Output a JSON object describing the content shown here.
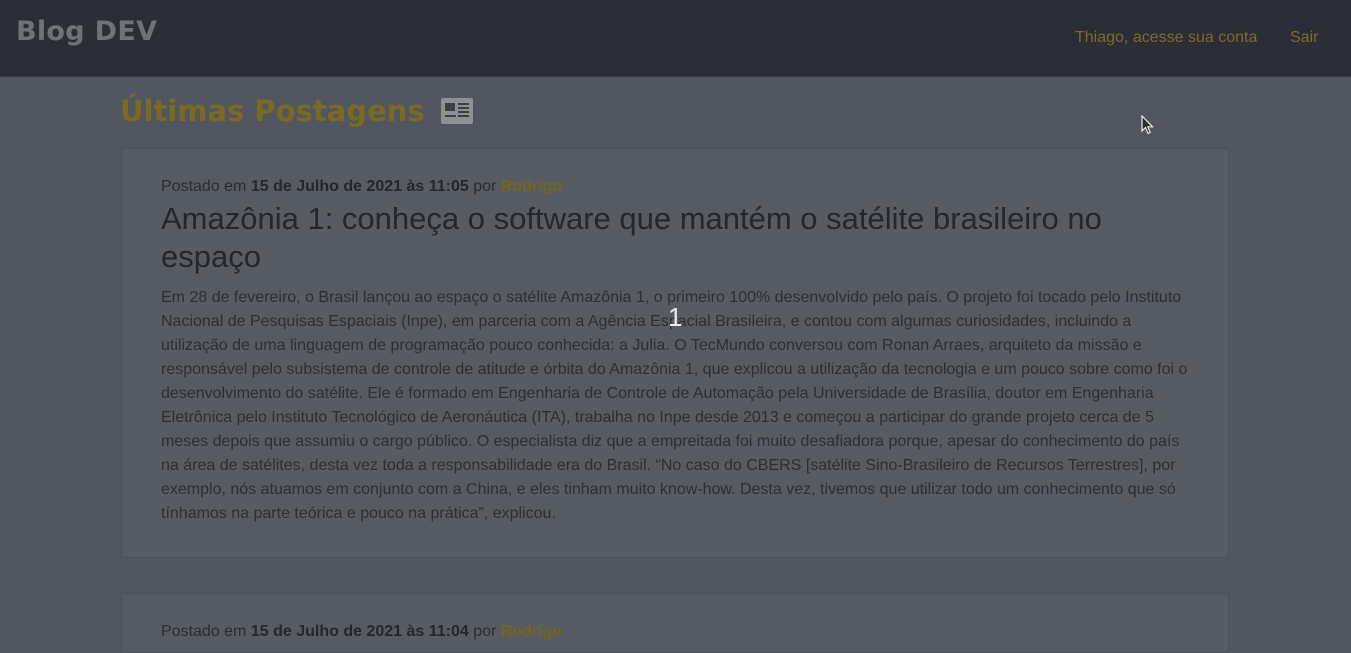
{
  "navbar": {
    "brand": "Blog DEV",
    "account_link": "Thiago, acesse sua conta",
    "logout_link": "Sair"
  },
  "page": {
    "title": "Últimas Postagens",
    "title_icon": "newspaper-icon"
  },
  "posts": [
    {
      "prefix": "Postado em",
      "date": "15 de Julho de 2021 às 11:05",
      "by": "por",
      "author": "Rodrigo",
      "title": "Amazônia 1: conheça o software que mantém o satélite brasileiro no espaço",
      "body": "Em 28 de fevereiro, o Brasil lançou ao espaço o satélite Amazônia 1, o primeiro 100% desenvolvido pelo país. O projeto foi tocado pelo Instituto Nacional de Pesquisas Espaciais (Inpe), em parceria com a Agência Espacial Brasileira, e contou com algumas curiosidades, incluindo a utilização de uma linguagem de programação pouco conhecida: a Julia. O TecMundo conversou com Ronan Arraes, arquiteto da missão e responsável pelo subsistema de controle de atitude e órbita do Amazônia 1, que explicou a utilização da tecnologia e um pouco sobre como foi o desenvolvimento do satélite. Ele é formado em Engenharia de Controle de Automação pela Universidade de Brasília, doutor em Engenharia Eletrônica pelo Instituto Tecnológico de Aeronáutica (ITA), trabalha no Inpe desde 2013 e começou a participar do grande projeto cerca de 5 meses depois que assumiu o cargo público. O especialista diz que a empreitada foi muito desafiadora porque, apesar do conhecimento do país na área de satélites, desta vez toda a responsabilidade era do Brasil. “No caso do CBERS [satélite Sino-Brasileiro de Recursos Terrestres], por exemplo, nós atuamos em conjunto com a China, e eles tinham muito know-how. Desta vez, tivemos que utilizar todo um conhecimento que só tínhamos na parte teórica e pouco na prática”, explicou."
    },
    {
      "prefix": "Postado em",
      "date": "15 de Julho de 2021 às 11:04",
      "by": "por",
      "author": "Rodrigo"
    }
  ],
  "overlay": {
    "number": "1"
  },
  "colors": {
    "accent": "#7a6a22",
    "navbar": "#2b2e37",
    "background": "#525660"
  }
}
